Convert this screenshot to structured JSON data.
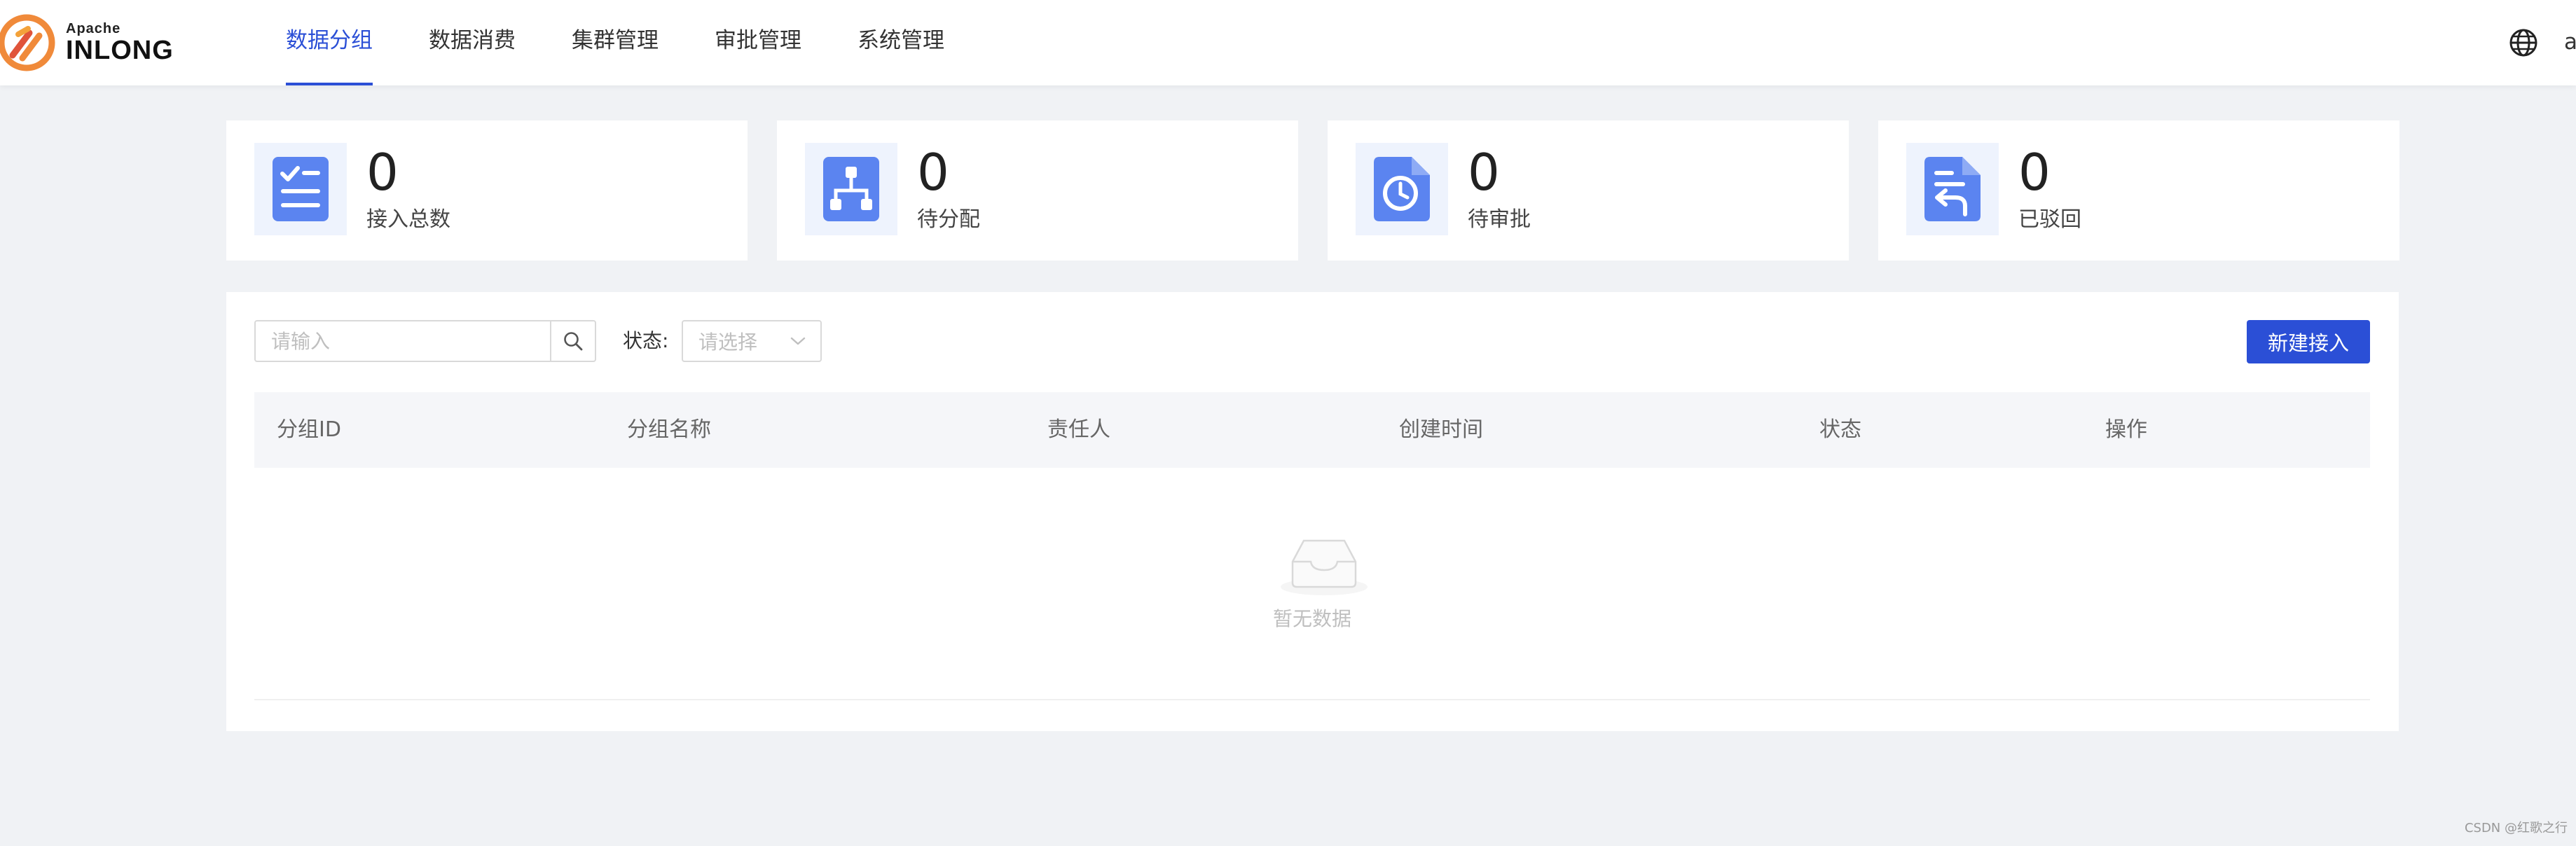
{
  "header": {
    "logo_top": "Apache",
    "logo_main": "INLONG",
    "nav": [
      {
        "label": "数据分组",
        "active": true
      },
      {
        "label": "数据消费",
        "active": false
      },
      {
        "label": "集群管理",
        "active": false
      },
      {
        "label": "审批管理",
        "active": false
      },
      {
        "label": "系统管理",
        "active": false
      }
    ],
    "user_label": "a"
  },
  "stats": [
    {
      "value": "0",
      "label": "接入总数",
      "icon": "checklist-icon"
    },
    {
      "value": "0",
      "label": "待分配",
      "icon": "hierarchy-icon"
    },
    {
      "value": "0",
      "label": "待审批",
      "icon": "clock-document-icon"
    },
    {
      "value": "0",
      "label": "已驳回",
      "icon": "return-document-icon"
    }
  ],
  "toolbar": {
    "search_placeholder": "请输入",
    "status_label": "状态:",
    "status_placeholder": "请选择",
    "create_label": "新建接入"
  },
  "table": {
    "columns": [
      "分组ID",
      "分组名称",
      "责任人",
      "创建时间",
      "状态",
      "操作"
    ],
    "rows": [],
    "empty_text": "暂无数据"
  },
  "watermark": "CSDN @红歌之行",
  "colors": {
    "primary": "#2b4fd6",
    "icon_blue": "#5b84f0",
    "icon_bg": "#eef3fd",
    "page_bg": "#f0f2f5"
  }
}
